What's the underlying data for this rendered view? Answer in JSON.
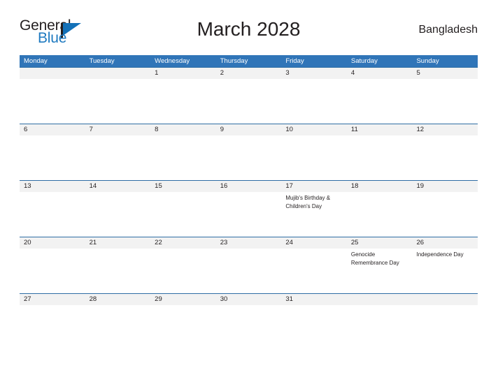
{
  "brand": {
    "name_part1": "General",
    "name_part2": "Blue",
    "flag_icon": "flag-triangle-icon"
  },
  "header": {
    "title": "March 2028",
    "country": "Bangladesh"
  },
  "colors": {
    "header_blue": "#3075b8",
    "row_rule_blue": "#2e6da4",
    "band_gray": "#f2f2f2",
    "logo_blue": "#1f7ac0",
    "text_dark": "#231f20"
  },
  "calendar": {
    "month": "March",
    "year": "2028",
    "weekdays": [
      "Monday",
      "Tuesday",
      "Wednesday",
      "Thursday",
      "Friday",
      "Saturday",
      "Sunday"
    ],
    "weeks": [
      [
        {
          "day": "",
          "events": []
        },
        {
          "day": "",
          "events": []
        },
        {
          "day": "1",
          "events": []
        },
        {
          "day": "2",
          "events": []
        },
        {
          "day": "3",
          "events": []
        },
        {
          "day": "4",
          "events": []
        },
        {
          "day": "5",
          "events": []
        }
      ],
      [
        {
          "day": "6",
          "events": []
        },
        {
          "day": "7",
          "events": []
        },
        {
          "day": "8",
          "events": []
        },
        {
          "day": "9",
          "events": []
        },
        {
          "day": "10",
          "events": []
        },
        {
          "day": "11",
          "events": []
        },
        {
          "day": "12",
          "events": []
        }
      ],
      [
        {
          "day": "13",
          "events": []
        },
        {
          "day": "14",
          "events": []
        },
        {
          "day": "15",
          "events": []
        },
        {
          "day": "16",
          "events": []
        },
        {
          "day": "17",
          "events": [
            "Mujib's Birthday &",
            "Children's Day"
          ]
        },
        {
          "day": "18",
          "events": []
        },
        {
          "day": "19",
          "events": []
        }
      ],
      [
        {
          "day": "20",
          "events": []
        },
        {
          "day": "21",
          "events": []
        },
        {
          "day": "22",
          "events": []
        },
        {
          "day": "23",
          "events": []
        },
        {
          "day": "24",
          "events": []
        },
        {
          "day": "25",
          "events": [
            "Genocide",
            "Remembrance Day"
          ]
        },
        {
          "day": "26",
          "events": [
            "Independence Day"
          ]
        }
      ],
      [
        {
          "day": "27",
          "events": []
        },
        {
          "day": "28",
          "events": []
        },
        {
          "day": "29",
          "events": []
        },
        {
          "day": "30",
          "events": []
        },
        {
          "day": "31",
          "events": []
        },
        {
          "day": "",
          "events": []
        },
        {
          "day": "",
          "events": []
        }
      ]
    ]
  }
}
